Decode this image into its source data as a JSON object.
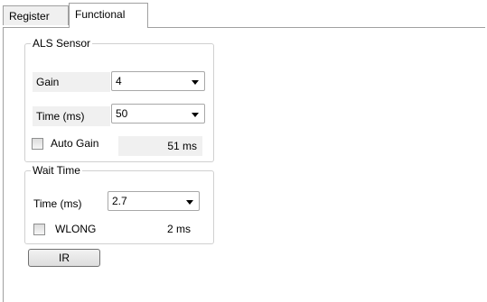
{
  "tabs": [
    {
      "label": "Register",
      "active": false
    },
    {
      "label": "Functional",
      "active": true
    }
  ],
  "als_sensor": {
    "legend": "ALS Sensor",
    "gain_label": "Gain",
    "gain_value": "4",
    "time_label": "Time (ms)",
    "time_value": "50",
    "auto_gain_label": "Auto Gain",
    "auto_gain_checked": false,
    "integration_readout": "51 ms"
  },
  "wait_time": {
    "legend": "Wait Time",
    "time_label": "Time (ms)",
    "time_value": "2.7",
    "wlong_label": "WLONG",
    "wlong_checked": false,
    "wait_readout": "2 ms"
  },
  "ir_button_label": "IR"
}
